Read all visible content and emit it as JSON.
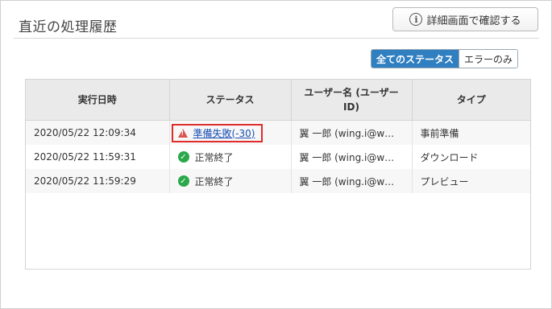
{
  "header": {
    "title": "直近の処理履歴",
    "detail_button_label": "詳細画面で確認する",
    "detail_button_icon": "info-icon"
  },
  "filters": {
    "all_label": "全てのステータス",
    "errors_only_label": "エラーのみ",
    "selected": "全てのステータス"
  },
  "table": {
    "headers": {
      "datetime": "実行日時",
      "status": "ステータス",
      "user": "ユーザー名 (ユーザーID)",
      "type": "タイプ"
    },
    "rows": [
      {
        "datetime": "2020/05/22 12:09:34",
        "status": "準備失敗(-30)",
        "status_icon": "warning-icon",
        "user": "翼 一郎 (wing.i@w…",
        "type": "事前準備"
      },
      {
        "datetime": "2020/05/22 11:59:31",
        "status": "正常終了",
        "status_icon": "check-circle-icon",
        "user": "翼 一郎 (wing.i@w…",
        "type": "ダウンロード"
      },
      {
        "datetime": "2020/05/22 11:59:29",
        "status": "正常終了",
        "status_icon": "check-circle-icon",
        "user": "翼 一郎 (wing.i@w…",
        "type": "プレビュー"
      }
    ]
  },
  "colors": {
    "accent": "#2f7fc1",
    "error": "#e02b2b",
    "success": "#2aa84a",
    "link": "#1a4fb5"
  }
}
